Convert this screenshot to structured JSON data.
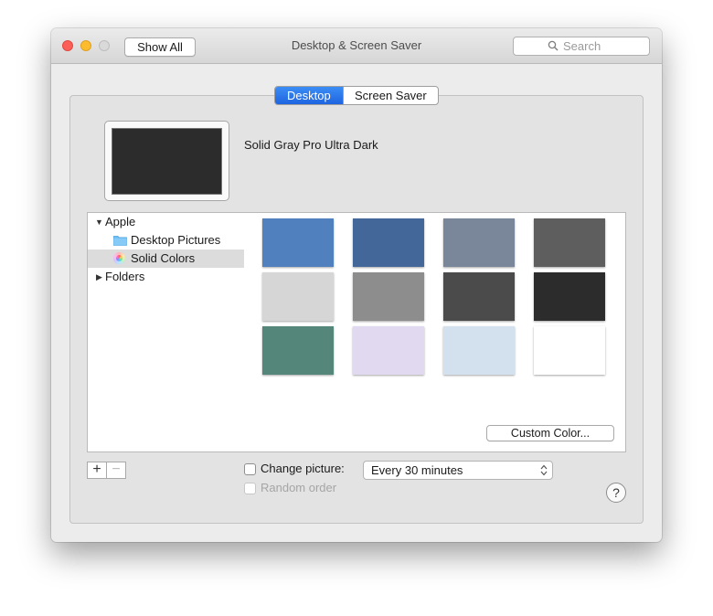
{
  "window": {
    "title": "Desktop & Screen Saver",
    "show_all_label": "Show All",
    "search_placeholder": "Search"
  },
  "tabs": [
    {
      "label": "Desktop",
      "selected": true
    },
    {
      "label": "Screen Saver",
      "selected": false
    }
  ],
  "preview": {
    "picture_name": "Solid Gray Pro Ultra Dark",
    "color": "#2c2c2c"
  },
  "sidebar": {
    "groups": [
      {
        "label": "Apple",
        "expanded": true,
        "items": [
          {
            "label": "Desktop Pictures",
            "icon": "folder-icon",
            "selected": false
          },
          {
            "label": "Solid Colors",
            "icon": "color-wheel-icon",
            "selected": true
          }
        ]
      },
      {
        "label": "Folders",
        "expanded": false,
        "items": []
      }
    ]
  },
  "swatches": [
    "#5080bd",
    "#44679a",
    "#7a8699",
    "#5e5e5e",
    "#d6d6d6",
    "#8d8d8d",
    "#4b4b4b",
    "#2c2c2c",
    "#548679",
    "#e1d9f0",
    "#d3e1ee",
    "#ffffff"
  ],
  "custom_color_label": "Custom Color...",
  "plus_label": "+",
  "minus_label": "−",
  "change_picture": {
    "label": "Change picture:",
    "checked": false
  },
  "interval": {
    "selected": "Every 30 minutes"
  },
  "random_order": {
    "label": "Random order",
    "checked": false,
    "enabled": false
  },
  "help_label": "?",
  "accent_color": "#1f64e0"
}
